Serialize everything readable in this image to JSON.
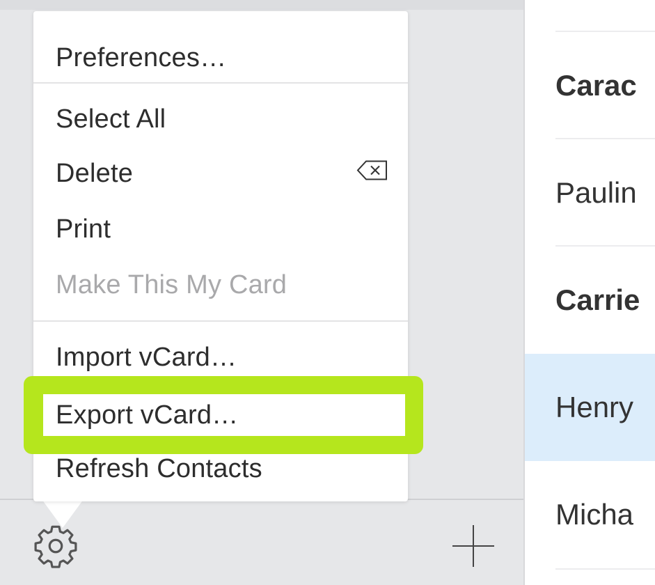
{
  "menu": {
    "items": [
      {
        "label": "Preferences…",
        "enabled": true
      },
      {
        "label": "Select All",
        "enabled": true
      },
      {
        "label": "Delete",
        "enabled": true,
        "shortcut_icon": "delete-key-icon"
      },
      {
        "label": "Print",
        "enabled": true
      },
      {
        "label": "Make This My Card",
        "enabled": false
      },
      {
        "label": "Import vCard…",
        "enabled": true
      },
      {
        "label": "Export vCard…",
        "enabled": true,
        "highlighted": true
      },
      {
        "label": "Refresh Contacts",
        "enabled": true
      }
    ]
  },
  "contacts": [
    {
      "name": "Carac",
      "bold": true,
      "selected": false
    },
    {
      "name": "Paulin",
      "bold": false,
      "selected": false
    },
    {
      "name": "Carrie",
      "bold": true,
      "selected": false
    },
    {
      "name": "Henry",
      "bold": false,
      "selected": true
    },
    {
      "name": "Micha",
      "bold": false,
      "selected": false
    }
  ],
  "icons": {
    "settings": "gear-icon",
    "add": "plus-icon",
    "delete_shortcut": "delete-key-icon"
  },
  "colors": {
    "highlight": "#b5e61d",
    "selected_row": "#dcedfb",
    "sidebar": "#e6e7e9",
    "disabled_text": "#a9a9ab"
  }
}
